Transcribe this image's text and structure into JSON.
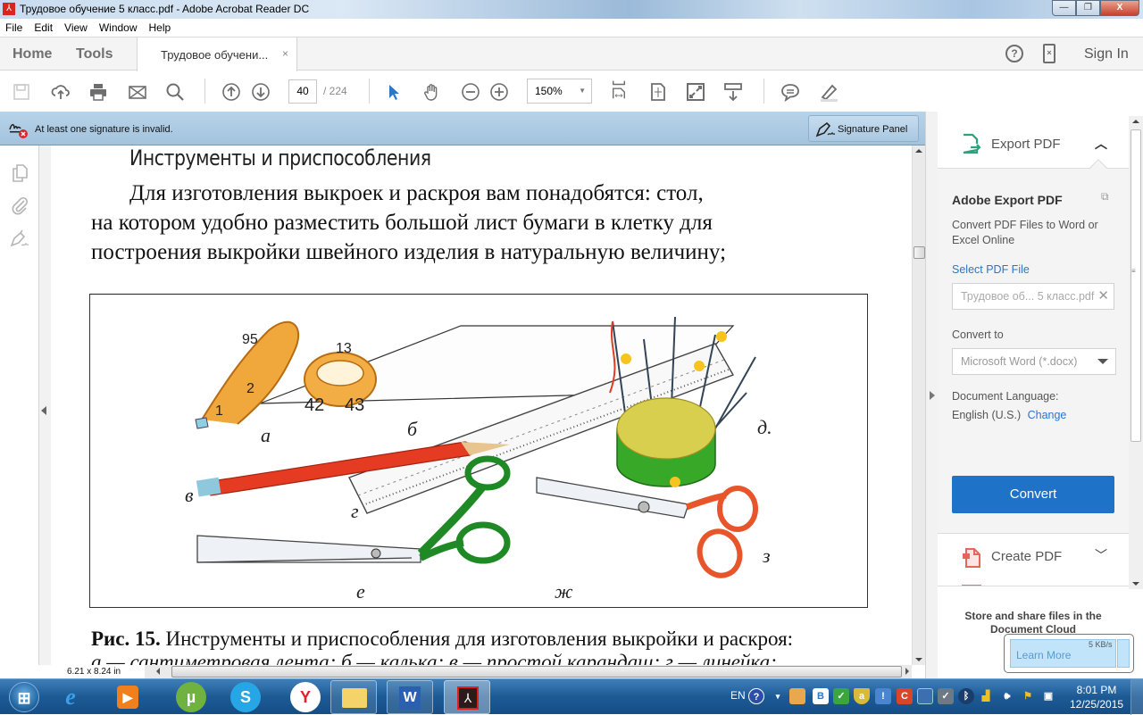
{
  "window": {
    "title": "Трудовое обучение 5 класс.pdf - Adobe Acrobat Reader DC",
    "minimize": "—",
    "restore": "❐",
    "close": "X"
  },
  "menu": [
    "File",
    "Edit",
    "View",
    "Window",
    "Help"
  ],
  "tabs": {
    "home": "Home",
    "tools": "Tools",
    "document": "Трудовое обучени...",
    "close": "×",
    "help": "?",
    "sign_in": "Sign In"
  },
  "toolbar": {
    "page_current": "40",
    "page_total": "/  224",
    "zoom": "150%",
    "icons": [
      "save-icon",
      "upload-cloud-icon",
      "print-icon",
      "email-icon",
      "search-icon",
      "page-up-icon",
      "page-down-icon",
      "select-cursor-icon",
      "hand-icon",
      "zoom-out-icon",
      "zoom-in-icon",
      "fit-width-icon",
      "fit-page-icon",
      "fullscreen-icon",
      "scroll-mode-icon",
      "comment-icon",
      "highlight-icon"
    ]
  },
  "signature_bar": {
    "message": "At least one signature is invalid.",
    "button": "Signature Panel"
  },
  "document": {
    "heading": "Инструменты и приспособления",
    "paragraph": [
      "Для изготовления выкроек и раскроя вам понадобятся: стол,",
      "на котором удобно разместить большой лист бумаги в клетку для",
      "построения выкройки швейного изделия в натуральную величину;"
    ],
    "figure_labels": {
      "a": "а",
      "b": "б",
      "v": "в",
      "g": "г",
      "d": "д.",
      "e": "е",
      "zh": "ж",
      "z": "з"
    },
    "caption_bold": "Рис. 15.",
    "caption": " Инструменты и приспособления для изготовления выкройки и раскроя:",
    "caption_line2": "а — сантиметровая лента; б — калька; в — простой карандаш; г — линейка;",
    "page_size": "6.21 x 8.24 in"
  },
  "right_pane": {
    "export_title": "Export PDF",
    "export_heading": "Adobe Export PDF",
    "export_desc": "Convert PDF Files to Word or Excel Online",
    "select_file": "Select PDF File",
    "file_name": "Трудовое об... 5 класс.pdf",
    "convert_to_label": "Convert to",
    "convert_to_value": "Microsoft Word (*.docx)",
    "doc_lang_label": "Document Language:",
    "doc_lang_value": "English (U.S.)",
    "doc_lang_change": "Change",
    "convert_button": "Convert",
    "create_pdf": "Create PDF",
    "store_share": "Store and share files in the Document Cloud"
  },
  "network_tooltip": {
    "learn_more": "Learn More",
    "speed": "5 KB/s"
  },
  "taskbar": {
    "apps": [
      "start",
      "internet-explorer",
      "media-player",
      "utorrent",
      "skype",
      "yandex-browser",
      "file-explorer",
      "microsoft-word",
      "adobe-reader"
    ],
    "language": "EN",
    "time": "8:01 PM",
    "date": "12/25/2015"
  }
}
